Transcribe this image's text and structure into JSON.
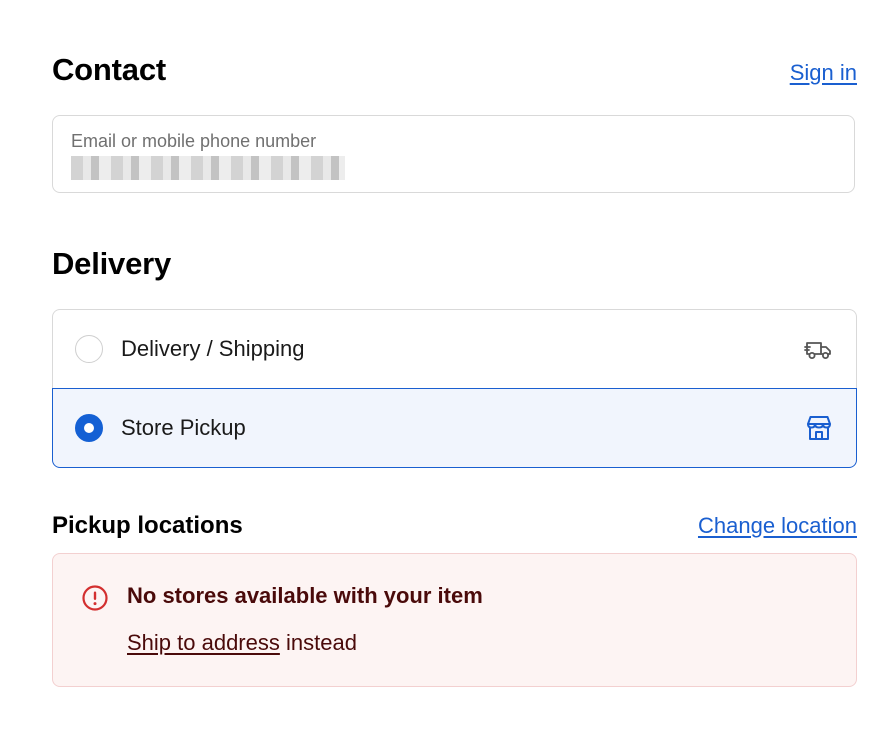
{
  "contact": {
    "title": "Contact",
    "sign_in_label": "Sign in",
    "field_label": "Email or mobile phone number"
  },
  "delivery": {
    "title": "Delivery",
    "options": [
      {
        "label": "Delivery / Shipping",
        "icon": "truck-icon",
        "selected": false
      },
      {
        "label": "Store Pickup",
        "icon": "store-icon",
        "selected": true
      }
    ]
  },
  "pickup": {
    "title": "Pickup locations",
    "change_location_label": "Change location",
    "notice": {
      "icon": "error-circle-icon",
      "title": "No stores available with your item",
      "link_label": "Ship to address",
      "suffix": "instead"
    }
  },
  "colors": {
    "accent": "#1a5fd0",
    "selected_bg": "#f1f5fd",
    "error": "#d32f2f",
    "notice_bg": "#fdf4f3",
    "notice_text": "#4a0a0a"
  }
}
